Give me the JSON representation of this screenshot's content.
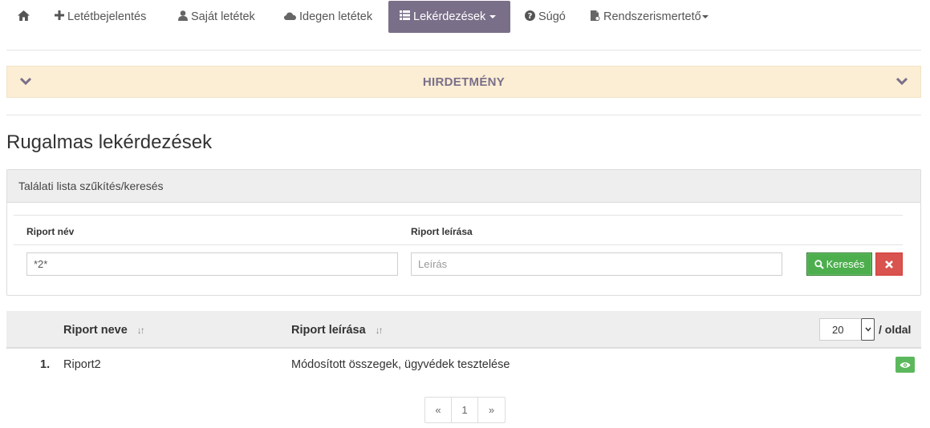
{
  "nav": {
    "items": [
      {
        "label": "",
        "icon": "home-icon"
      },
      {
        "label": "Letétbejelentés",
        "icon": "plus-icon"
      },
      {
        "label": "Saját letétek",
        "icon": "user-icon"
      },
      {
        "label": "Idegen letétek",
        "icon": "cloud-icon"
      },
      {
        "label": "Lekérdezések",
        "icon": "list-icon",
        "active": true,
        "dropdown": true
      },
      {
        "label": "Súgó",
        "icon": "question-circle-icon"
      },
      {
        "label": "Rendszerismertető",
        "icon": "file-icon",
        "dropdown": true
      }
    ]
  },
  "notice": {
    "title": "HIRDETMÉNY"
  },
  "page": {
    "title": "Rugalmas lekérdezések"
  },
  "search_panel": {
    "heading": "Találati lista szűkítés/keresés",
    "name_label": "Riport név",
    "name_value": "*2*",
    "desc_label": "Riport leírása",
    "desc_placeholder": "Leírás",
    "search_button": "Keresés"
  },
  "table": {
    "columns": [
      "Riport neve",
      "Riport leírása"
    ],
    "page_size": "20",
    "per_page_label": "/ oldal",
    "rows": [
      {
        "index": "1.",
        "name": "Riport2",
        "description": "Módosított összegek, ügyvédek tesztelése"
      }
    ]
  },
  "pagination": {
    "prev": "«",
    "current": "1",
    "next": "»"
  },
  "colors": {
    "accent": "#7a6f89",
    "notice_bg": "#fbeed5",
    "success": "#5cb85c",
    "danger": "#d9534f"
  }
}
